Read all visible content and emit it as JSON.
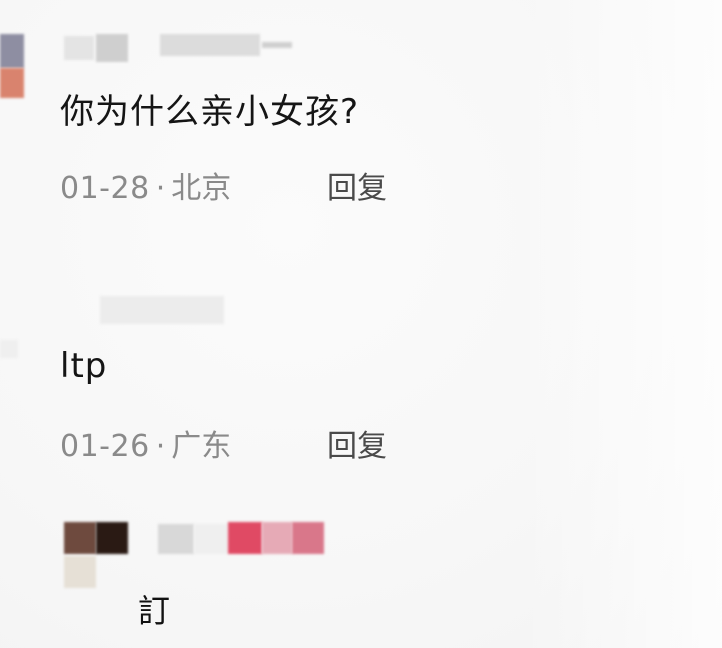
{
  "comments": [
    {
      "text": "你为什么亲小女孩?",
      "date": "01-28",
      "separator": "·",
      "location": "北京",
      "reply_label": "回复"
    },
    {
      "text": "ltp",
      "date": "01-26",
      "separator": "·",
      "location": "广东",
      "reply_label": "回复"
    }
  ],
  "partial_comment": {
    "text": "訂"
  }
}
